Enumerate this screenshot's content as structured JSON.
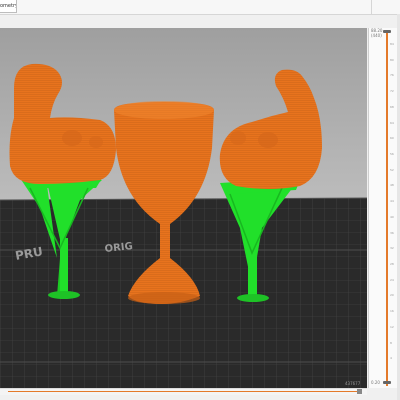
{
  "app": {
    "tab_label": "ometry"
  },
  "colors": {
    "model": "#e8731d",
    "support": "#21e02a",
    "bed": "#2c2c2c",
    "background": "#b9b9b9",
    "slider": "#e47a2a"
  },
  "bed": {
    "logo_left": "PRU",
    "logo_center": "ORIG"
  },
  "slider": {
    "top_value": "88.20",
    "top_sub": "(440)",
    "bottom_value": "0.20",
    "ticks": [
      "84",
      "80",
      "76",
      "72",
      "68",
      "64",
      "60",
      "56",
      "52",
      "48",
      "44",
      "40",
      "36",
      "32",
      "28",
      "24",
      "20",
      "16",
      "12",
      "8",
      "4"
    ]
  },
  "bottom_bar": {
    "label": "437677"
  },
  "icons": {
    "model_goblet": "goblet",
    "model_arms": "flexing-arm"
  }
}
